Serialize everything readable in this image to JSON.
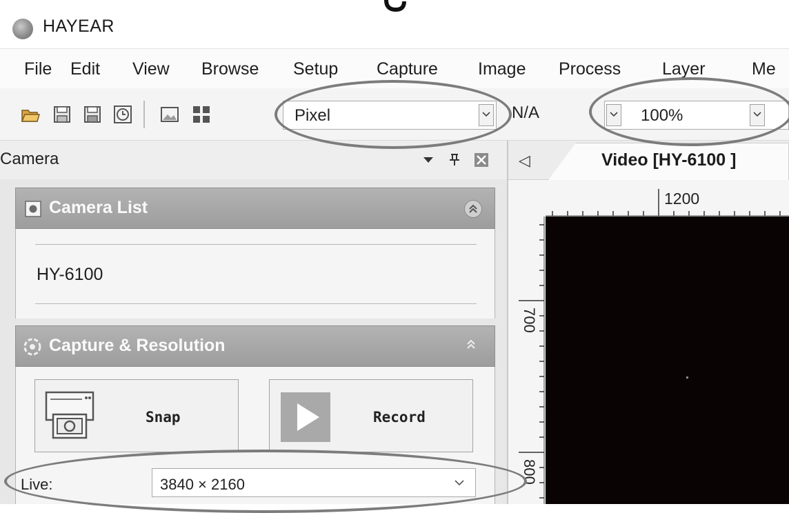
{
  "app": {
    "title": "HAYEAR",
    "logo_icon": "camera-lens-logo"
  },
  "menu": [
    "File",
    "Edit",
    "View",
    "Browse",
    "Setup",
    "Capture",
    "Image",
    "Process",
    "Layer",
    "Me"
  ],
  "toolbar": {
    "icons": [
      "open-folder-icon",
      "save-icon",
      "save-as-icon",
      "clock-icon",
      "image-icon",
      "grid-icon"
    ],
    "unit_value": "Pixel",
    "na_label": "N/A",
    "zoom_value": "100%"
  },
  "dock": {
    "title": "Camera",
    "camera_list": {
      "title": "Camera List",
      "items": [
        "HY-6100"
      ]
    },
    "capture": {
      "title": "Capture & Resolution",
      "snap_label": "Snap",
      "record_label": "Record",
      "live_label": "Live:",
      "live_resolution": "3840 × 2160"
    }
  },
  "video": {
    "tab_label": "Video [HY-6100 ]",
    "ruler_h_label": "1200",
    "ruler_v_labels": [
      "700",
      "800"
    ]
  },
  "colors": {
    "panel_header": "#a8a8a8",
    "highlight_oval": "#7c7c7c",
    "video_bg": "#090304"
  }
}
